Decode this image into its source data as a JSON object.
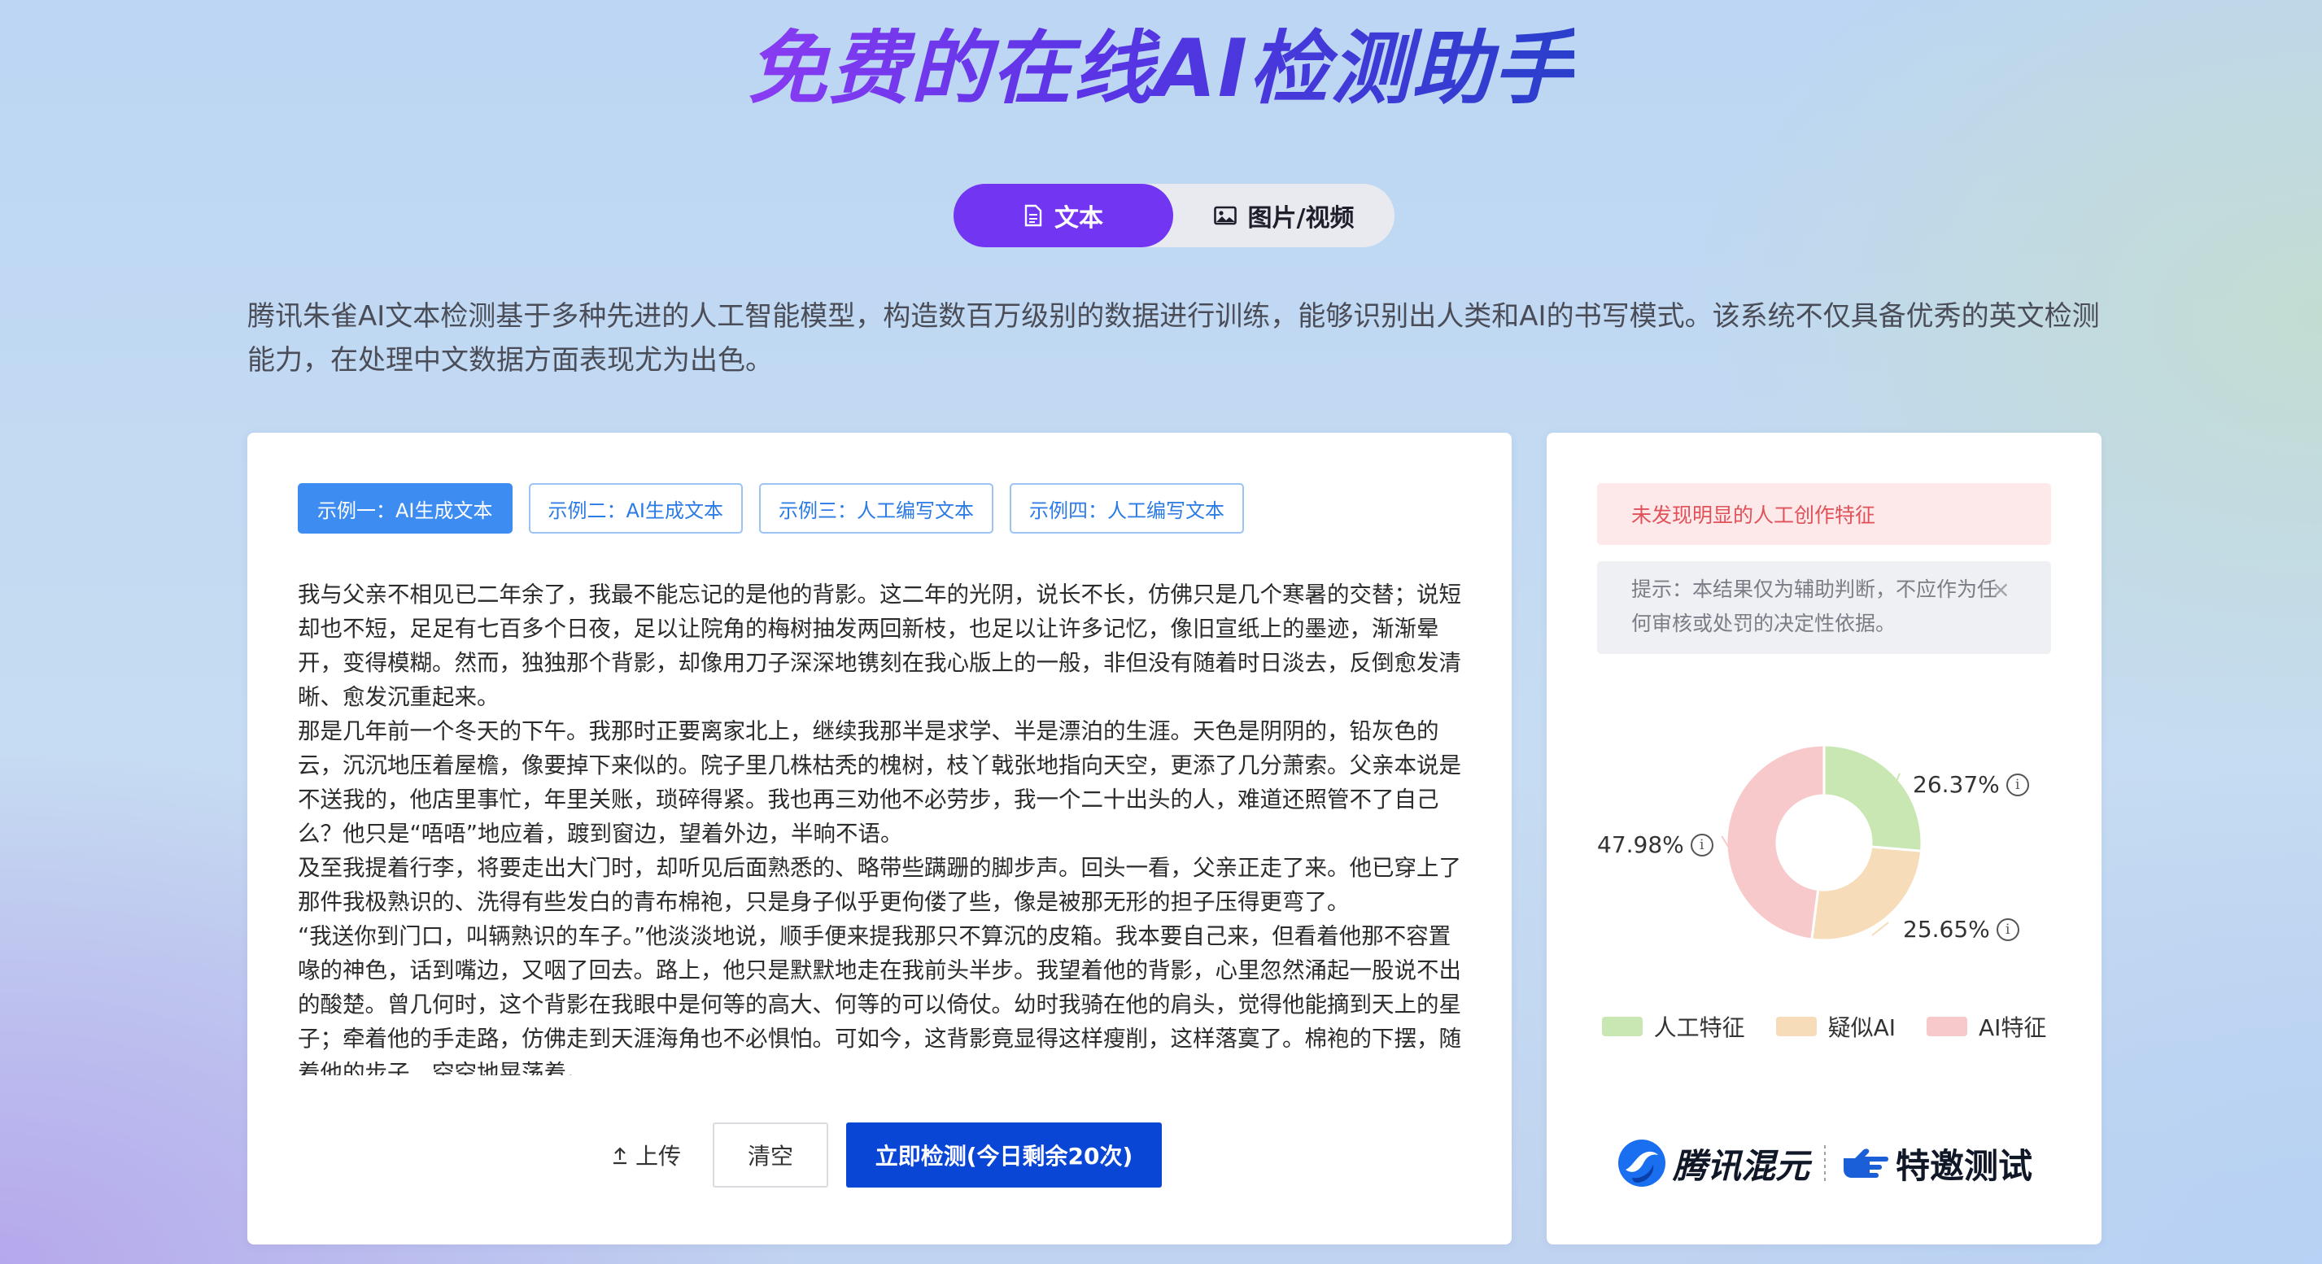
{
  "header": {
    "title": "免费的在线AI检测助手"
  },
  "tabs": [
    {
      "label": "文本",
      "icon": "document-icon",
      "active": true
    },
    {
      "label": "图片/视频",
      "icon": "image-icon",
      "active": false
    }
  ],
  "description": "腾讯朱雀AI文本检测基于多种先进的人工智能模型，构造数百万级别的数据进行训练，能够识别出人类和AI的书写模式。该系统不仅具备优秀的英文检测能力，在处理中文数据方面表现尤为出色。",
  "examples": [
    {
      "label": "示例一：AI生成文本",
      "active": true
    },
    {
      "label": "示例二：AI生成文本",
      "active": false
    },
    {
      "label": "示例三：人工编写文本",
      "active": false
    },
    {
      "label": "示例四：人工编写文本",
      "active": false
    }
  ],
  "input_text": [
    "我与父亲不相见已二年余了，我最不能忘记的是他的背影。这二年的光阴，说长不长，仿佛只是几个寒暑的交替；说短却也不短，足足有七百多个日夜，足以让院角的梅树抽发两回新枝，也足以让许多记忆，像旧宣纸上的墨迹，渐渐晕开，变得模糊。然而，独独那个背影，却像用刀子深深地镌刻在我心版上的一般，非但没有随着时日淡去，反倒愈发清晰、愈发沉重起来。",
    "那是几年前一个冬天的下午。我那时正要离家北上，继续我那半是求学、半是漂泊的生涯。天色是阴阴的，铅灰色的云，沉沉地压着屋檐，像要掉下来似的。院子里几株枯秃的槐树，枝丫戟张地指向天空，更添了几分萧索。父亲本说是不送我的，他店里事忙，年里关账，琐碎得紧。我也再三劝他不必劳步，我一个二十出头的人，难道还照管不了自己么？他只是“唔唔”地应着，踱到窗边，望着外边，半晌不语。",
    "及至我提着行李，将要走出大门时，却听见后面熟悉的、略带些蹒跚的脚步声。回头一看，父亲正走了来。他已穿上了那件我极熟识的、洗得有些发白的青布棉袍，只是身子似乎更佝偻了些，像是被那无形的担子压得更弯了。",
    "“我送你到门口，叫辆熟识的车子。”他淡淡地说，顺手便来提我那只不算沉的皮箱。我本要自己来，但看着他那不容置喙的神色，话到嘴边，又咽了回去。路上，他只是默默地走在我前头半步。我望着他的背影，心里忽然涌起一股说不出的酸楚。曾几何时，这个背影在我眼中是何等的高大、何等的可以倚仗。幼时我骑在他的肩头，觉得他能摘到天上的星子；牵着他的手走路，仿佛走到天涯海角也不必惧怕。可如今，这背影竟显得这样瘦削，这样落寞了。棉袍的下摆，随着他的步子，空空地晃荡着。"
  ],
  "actions": {
    "upload_label": "上传",
    "clear_label": "清空",
    "detect_label": "立即检测(今日剩余20次)"
  },
  "result": {
    "verdict": "未发现明显的人工创作特征",
    "hint": "提示：本结果仅为辅助判断，不应作为任何审核或处罚的决定性依据。",
    "close": "×"
  },
  "chart_data": {
    "type": "pie",
    "donut": true,
    "categories": [
      "人工特征",
      "疑似AI",
      "AI特征"
    ],
    "values": [
      26.37,
      25.65,
      47.98
    ],
    "value_labels": [
      "26.37%",
      "25.65%",
      "47.98%"
    ],
    "colors": [
      "#c8e7b2",
      "#f6dcb8",
      "#f8c9cb"
    ],
    "legend_position": "bottom"
  },
  "brand": {
    "name1": "腾讯混元",
    "name2": "特邀测试"
  }
}
